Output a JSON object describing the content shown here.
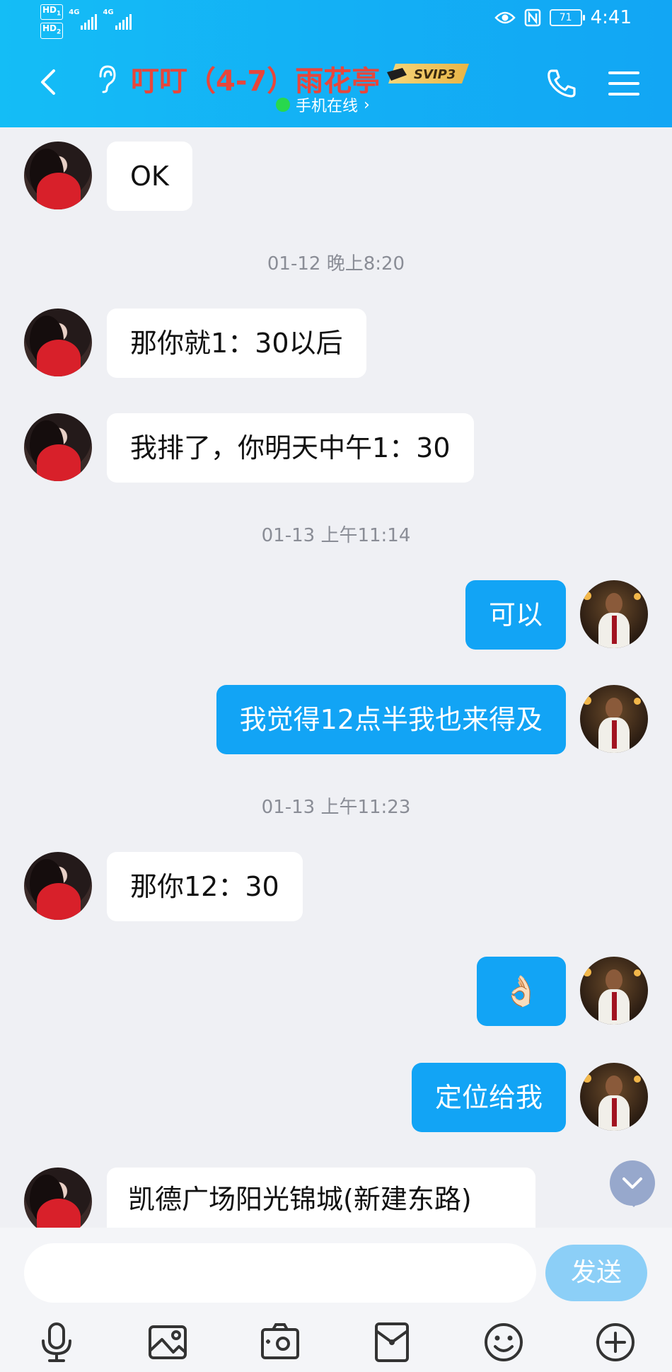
{
  "status_bar": {
    "hd1": "HD",
    "hd1_sub": "1",
    "hd2": "HD",
    "hd2_sub": "2",
    "net1": "4G",
    "net2": "4G",
    "battery": "71",
    "time": "4:41"
  },
  "header": {
    "title": "叮叮（4-7）雨花亭",
    "badge": "SVIP3",
    "online_status": "手机在线",
    "online_arrow": "›",
    "title_color": "#e8463b",
    "accent": "#12a4f5",
    "online_dot_color": "#28d84d"
  },
  "messages": [
    {
      "type": "msg",
      "side": "in",
      "text": "OK"
    },
    {
      "type": "time",
      "text": "01-12 晚上8:20"
    },
    {
      "type": "msg",
      "side": "in",
      "text": "那你就1：30以后"
    },
    {
      "type": "msg",
      "side": "in",
      "text": "我排了，你明天中午1：30"
    },
    {
      "type": "time",
      "text": "01-13 上午11:14"
    },
    {
      "type": "msg",
      "side": "out",
      "text": "可以"
    },
    {
      "type": "msg",
      "side": "out",
      "text": "我觉得12点半我也来得及"
    },
    {
      "type": "time",
      "text": "01-13 上午11:23"
    },
    {
      "type": "msg",
      "side": "in",
      "text": "那你12：30"
    },
    {
      "type": "msg",
      "side": "out",
      "text": "👌🏻"
    },
    {
      "type": "msg",
      "side": "out",
      "text": "定位给我"
    },
    {
      "type": "msg",
      "side": "in",
      "text": "凯德广场阳光锦城(新建东路)"
    }
  ],
  "input": {
    "placeholder": "",
    "send_label": "发送"
  },
  "toolbar_icons": [
    "microphone-icon",
    "image-icon",
    "camera-icon",
    "red-packet-icon",
    "emoji-icon",
    "plus-icon"
  ]
}
